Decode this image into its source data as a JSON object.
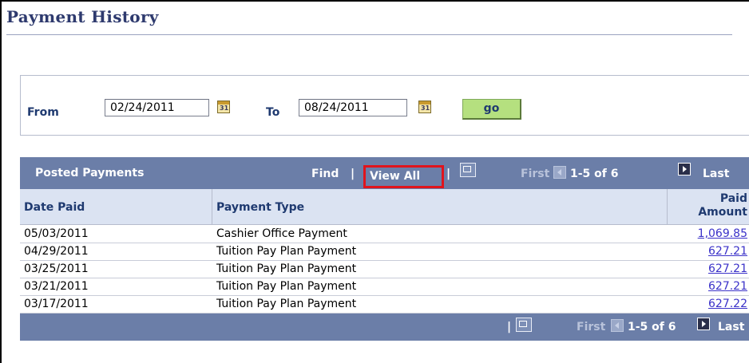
{
  "page": {
    "title": "Payment History"
  },
  "filter": {
    "from_label": "From",
    "from_value": "02/24/2011",
    "to_label": "To",
    "to_value": "08/24/2011",
    "calendar_icon_text": "31",
    "go_label": "go"
  },
  "grid": {
    "title": "Posted Payments",
    "find_label": "Find",
    "view_all_label": "View All",
    "separator": "|",
    "first_label": "First",
    "count_label": "1-5 of 6",
    "last_label": "Last",
    "columns": {
      "date_paid": "Date Paid",
      "payment_type": "Payment Type",
      "paid_amount_line1": "Paid",
      "paid_amount_line2": "Amount"
    },
    "rows": [
      {
        "date": "05/03/2011",
        "type": "Cashier Office Payment",
        "amount": "1,069.85"
      },
      {
        "date": "04/29/2011",
        "type": "Tuition Pay Plan Payment",
        "amount": "627.21"
      },
      {
        "date": "03/25/2011",
        "type": "Tuition Pay Plan Payment",
        "amount": "627.21"
      },
      {
        "date": "03/21/2011",
        "type": "Tuition Pay Plan Payment",
        "amount": "627.21"
      },
      {
        "date": "03/17/2011",
        "type": "Tuition Pay Plan Payment",
        "amount": "627.22"
      }
    ]
  },
  "colors": {
    "header_bar": "#6b7ea8",
    "column_header_bg": "#dbe3f2",
    "label_text": "#1f3a70",
    "link": "#3b32c9",
    "go_button": "#b5e07f",
    "highlight_box": "#e0141c"
  },
  "icons": {
    "calendar": "calendar-icon",
    "new_window": "new-window-icon",
    "prev": "previous-arrow-icon",
    "next": "next-arrow-icon"
  }
}
